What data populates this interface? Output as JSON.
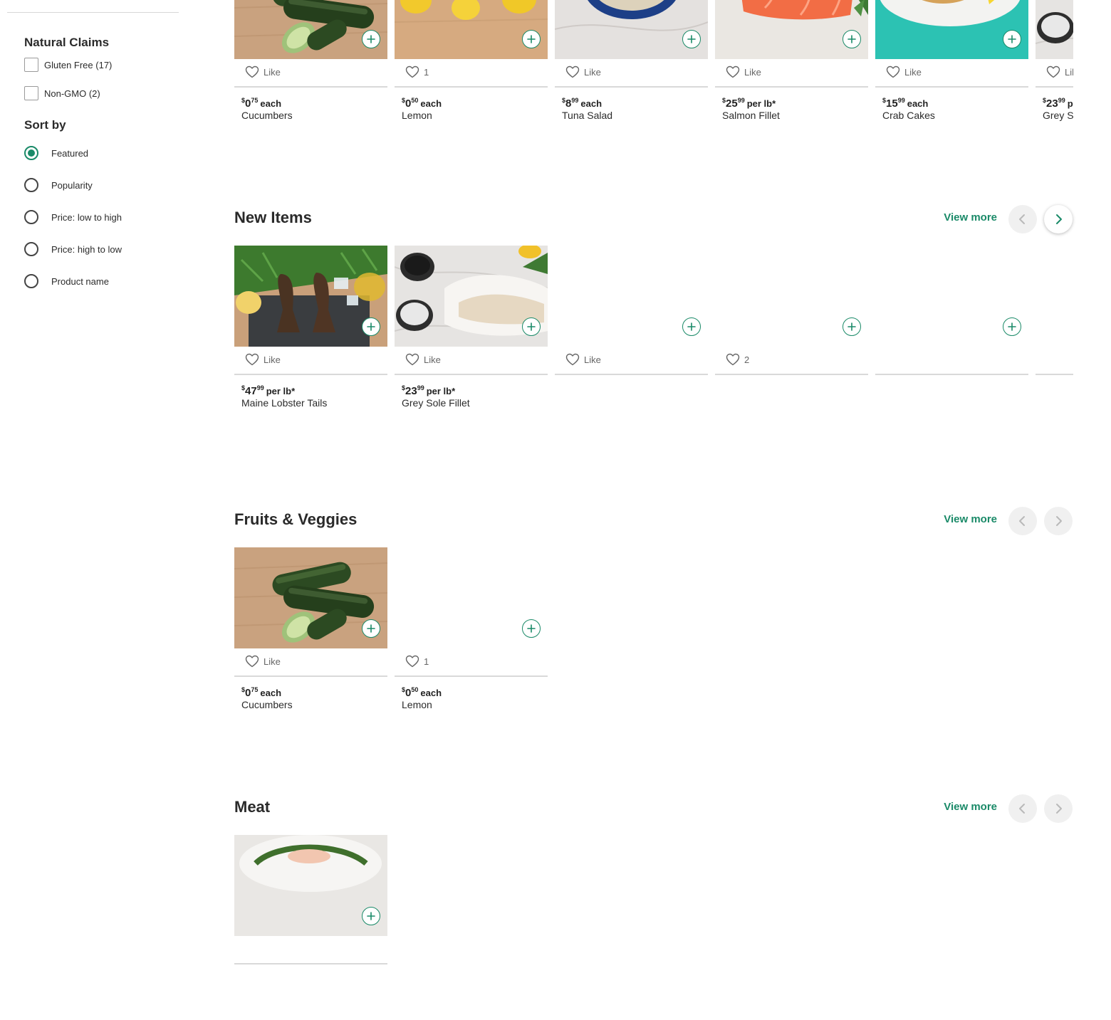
{
  "sidebar": {
    "natural_claims_heading": "Natural Claims",
    "claims": [
      {
        "label": "Gluten Free (17)",
        "checked": false
      },
      {
        "label": "Non-GMO (2)",
        "checked": false
      }
    ],
    "sort_heading": "Sort by",
    "sort_options": [
      {
        "label": "Featured",
        "selected": true
      },
      {
        "label": "Popularity",
        "selected": false
      },
      {
        "label": "Price: low to high",
        "selected": false
      },
      {
        "label": "Price: high to low",
        "selected": false
      },
      {
        "label": "Product name",
        "selected": false
      }
    ]
  },
  "colors": {
    "accent": "#1a8a68",
    "divider": "#d9d9d9",
    "nav_bg": "#f0f0f0"
  },
  "icons": {
    "add": "plus-circle-icon",
    "like": "heart-icon",
    "prev": "chevron-left-icon",
    "next": "chevron-right-icon"
  },
  "sections": [
    {
      "title": "",
      "cards": [
        {
          "dollars": "0",
          "cents": "75",
          "unit": "each",
          "name": "Cucumbers",
          "like": "Like",
          "image": "cucumber"
        },
        {
          "dollars": "0",
          "cents": "50",
          "unit": "each",
          "name": "Lemon",
          "like": "1",
          "image": "lemon"
        },
        {
          "dollars": "8",
          "cents": "99",
          "unit": "each",
          "name": "Tuna Salad",
          "like": "Like",
          "image": "tuna"
        },
        {
          "dollars": "25",
          "cents": "99",
          "unit": "per lb*",
          "name": "Salmon Fillet",
          "like": "Like",
          "image": "salmon"
        },
        {
          "dollars": "15",
          "cents": "99",
          "unit": "each",
          "name": "Crab Cakes",
          "like": "Like",
          "image": "crab"
        },
        {
          "dollars": "23",
          "cents": "99",
          "unit": "per lb*",
          "name": "Grey Sole Fillet",
          "like": "Like",
          "image": "sole"
        }
      ]
    },
    {
      "title": "New Items",
      "view_more": "View more",
      "cards": [
        {
          "dollars": "47",
          "cents": "99",
          "unit": "per lb*",
          "name": "Maine Lobster Tails",
          "like": "Like",
          "image": "lobster"
        },
        {
          "dollars": "23",
          "cents": "99",
          "unit": "per lb*",
          "name": "Grey Sole Fillet",
          "like": "Like",
          "image": "sole"
        },
        {
          "like": "Like",
          "image": "none"
        },
        {
          "like": "2",
          "image": "none"
        },
        {
          "image": "none"
        },
        {
          "image": "none"
        }
      ]
    },
    {
      "title": "Fruits & Veggies",
      "view_more": "View more",
      "cards": [
        {
          "dollars": "0",
          "cents": "75",
          "unit": "each",
          "name": "Cucumbers",
          "like": "Like",
          "image": "cucumber"
        },
        {
          "dollars": "0",
          "cents": "50",
          "unit": "each",
          "name": "Lemon",
          "like": "1",
          "image": "none"
        }
      ]
    },
    {
      "title": "Meat",
      "view_more": "View more",
      "cards": [
        {
          "image": "meat"
        }
      ]
    }
  ]
}
